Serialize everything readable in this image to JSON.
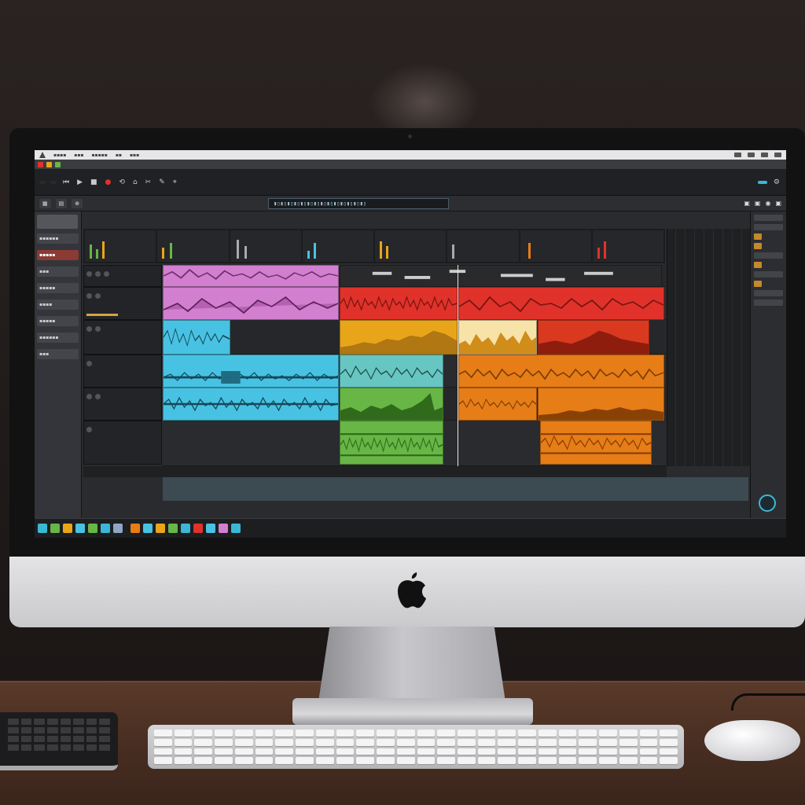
{
  "window": {
    "title": "",
    "transport": {
      "position": "",
      "tempo": "",
      "cpu": ""
    }
  },
  "colors": {
    "pink": "#d27fd0",
    "red": "#e0322a",
    "orange": "#e77d17",
    "amber": "#e9a51a",
    "cyan": "#48c2e2",
    "green": "#67b646",
    "accent": "#3bb7d6"
  },
  "icons": {
    "playhead": "playhead-icon",
    "apple_logo": "apple-logo-icon",
    "transport_play": "play-icon",
    "transport_stop": "stop-icon",
    "transport_record": "record-icon"
  },
  "tracks": [
    {
      "name": "",
      "color": "#d27fd0"
    },
    {
      "name": "",
      "color": "#d27fd0"
    },
    {
      "name": "",
      "color": "#48c2e2"
    },
    {
      "name": "",
      "color": "#48c2e2"
    },
    {
      "name": "",
      "color": "#48c2e2"
    },
    {
      "name": "",
      "color": "#67b646"
    }
  ]
}
